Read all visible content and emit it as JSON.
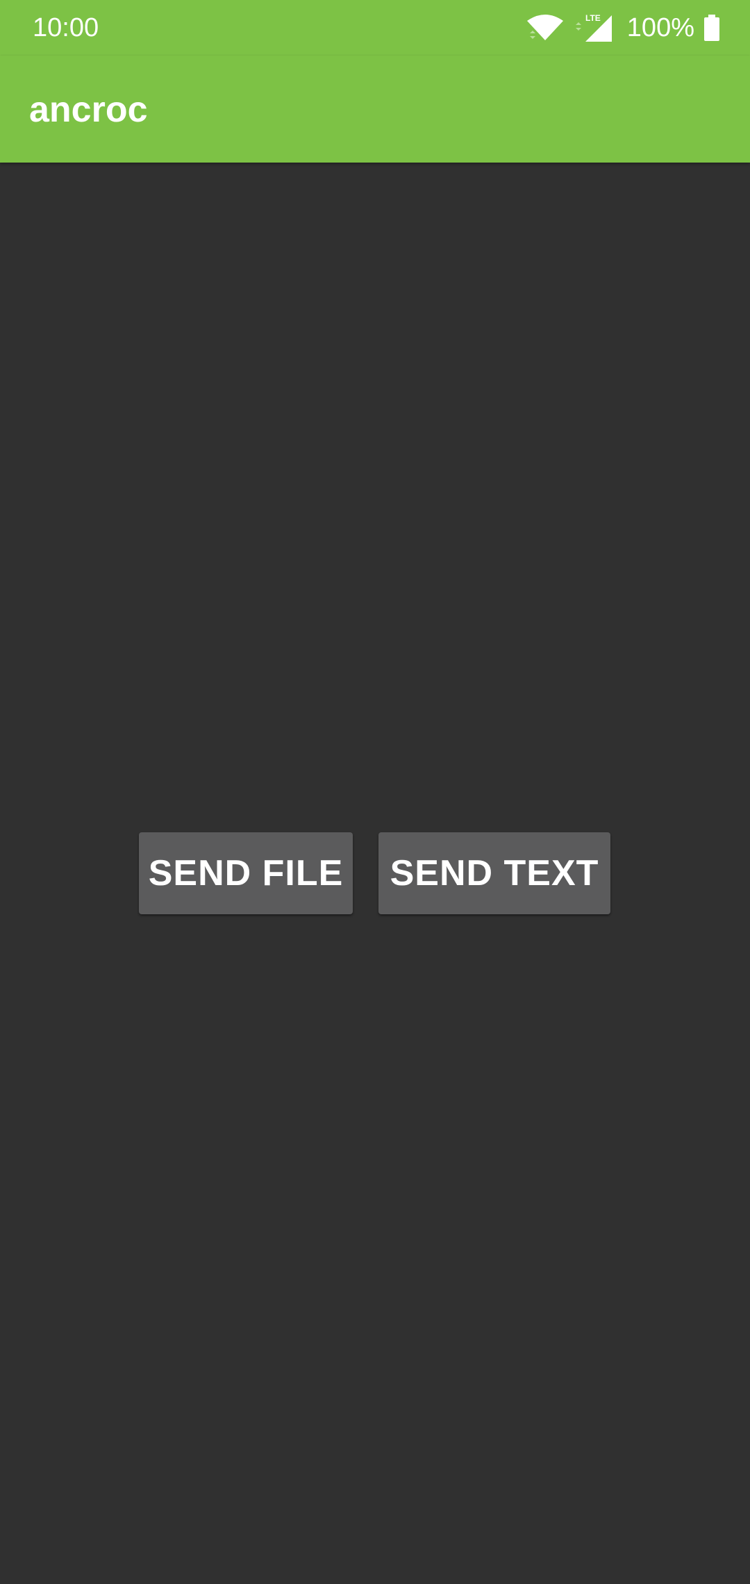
{
  "status_bar": {
    "time": "10:00",
    "network_label": "LTE",
    "battery": "100%",
    "icons": [
      "wifi-icon",
      "signal-icon",
      "battery-icon"
    ]
  },
  "toolbar": {
    "title": "ancroc"
  },
  "actions": {
    "send_file": "SEND FILE",
    "send_text": "SEND TEXT"
  },
  "colors": {
    "primary": "#7dc245",
    "background": "#303030",
    "button": "#5b5b5c",
    "text": "#ffffff"
  }
}
